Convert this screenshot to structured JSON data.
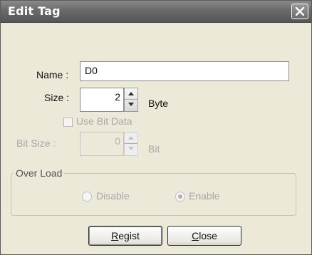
{
  "dialog": {
    "title": "Edit Tag"
  },
  "name": {
    "label": "Name :",
    "value": "D0"
  },
  "size": {
    "label": "Size :",
    "value": "2",
    "unit": "Byte"
  },
  "use_bit_data": {
    "label": "Use Bit Data",
    "checked": false,
    "enabled": false
  },
  "bit_size": {
    "label": "Bit Size :",
    "value": "0",
    "unit": "Bit",
    "enabled": false
  },
  "over_load": {
    "legend": "Over Load",
    "options": [
      {
        "label": "Disable",
        "selected": false
      },
      {
        "label": "Enable",
        "selected": true
      }
    ],
    "enabled": false
  },
  "buttons": {
    "regist": {
      "label": "Regist",
      "mnemonic": "R"
    },
    "close": {
      "label": "Close",
      "mnemonic": "C"
    }
  },
  "icons": {
    "close": "close-icon",
    "spin_up": "arrow-up-icon",
    "spin_down": "arrow-down-icon"
  }
}
